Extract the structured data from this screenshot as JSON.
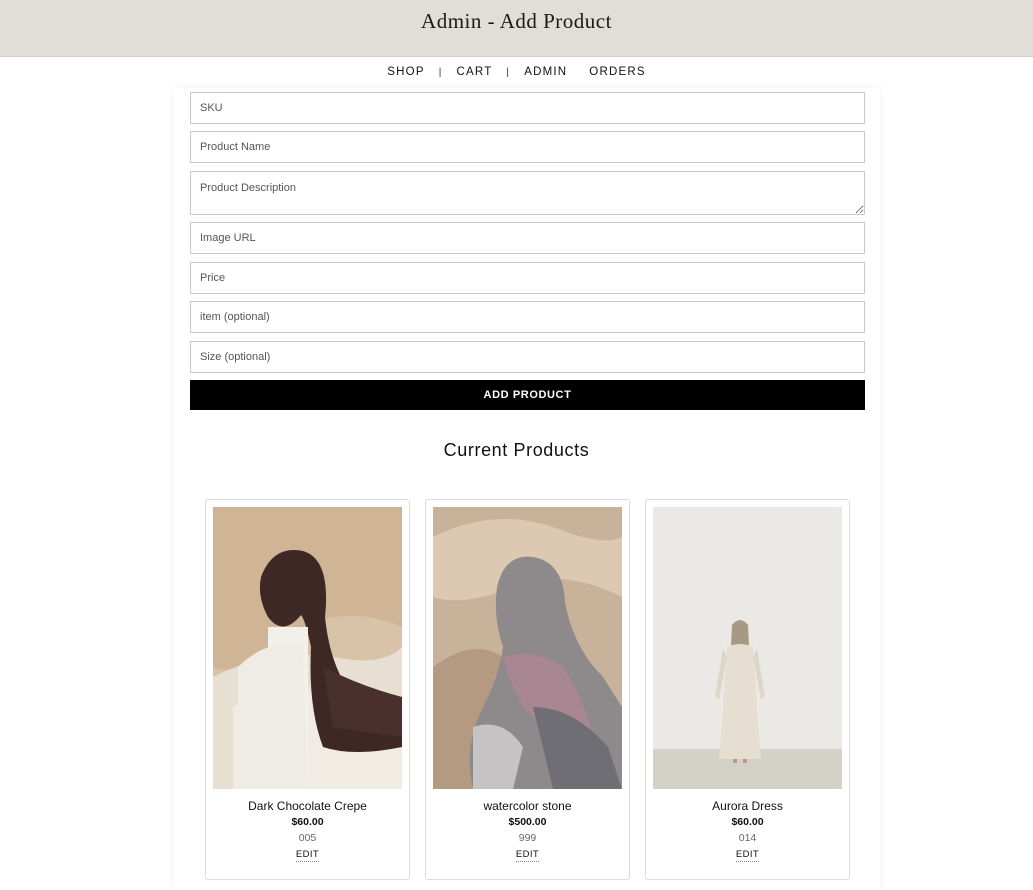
{
  "header": {
    "title": "Admin - Add Product"
  },
  "nav": {
    "shop": "SHOP",
    "cart": "CART",
    "admin": "ADMIN",
    "orders": "ORDERS",
    "separator": "|"
  },
  "form": {
    "sku_placeholder": "SKU",
    "name_placeholder": "Product Name",
    "description_placeholder": "Product Description",
    "image_placeholder": "Image URL",
    "price_placeholder": "Price",
    "item_placeholder": "item (optional)",
    "size_placeholder": "Size (optional)",
    "submit_label": "ADD PRODUCT"
  },
  "products_section": {
    "title": "Current Products"
  },
  "products": [
    {
      "name": "Dark Chocolate Crepe",
      "price": "$60.00",
      "sku": "005",
      "edit_label": "EDIT"
    },
    {
      "name": "watercolor stone",
      "price": "$500.00",
      "sku": "999",
      "edit_label": "EDIT"
    },
    {
      "name": "Aurora Dress",
      "price": "$60.00",
      "sku": "014",
      "edit_label": "EDIT"
    }
  ],
  "colors": {
    "header_bg": "#e1ddd7",
    "button_bg": "#000000",
    "button_text": "#ffffff"
  }
}
